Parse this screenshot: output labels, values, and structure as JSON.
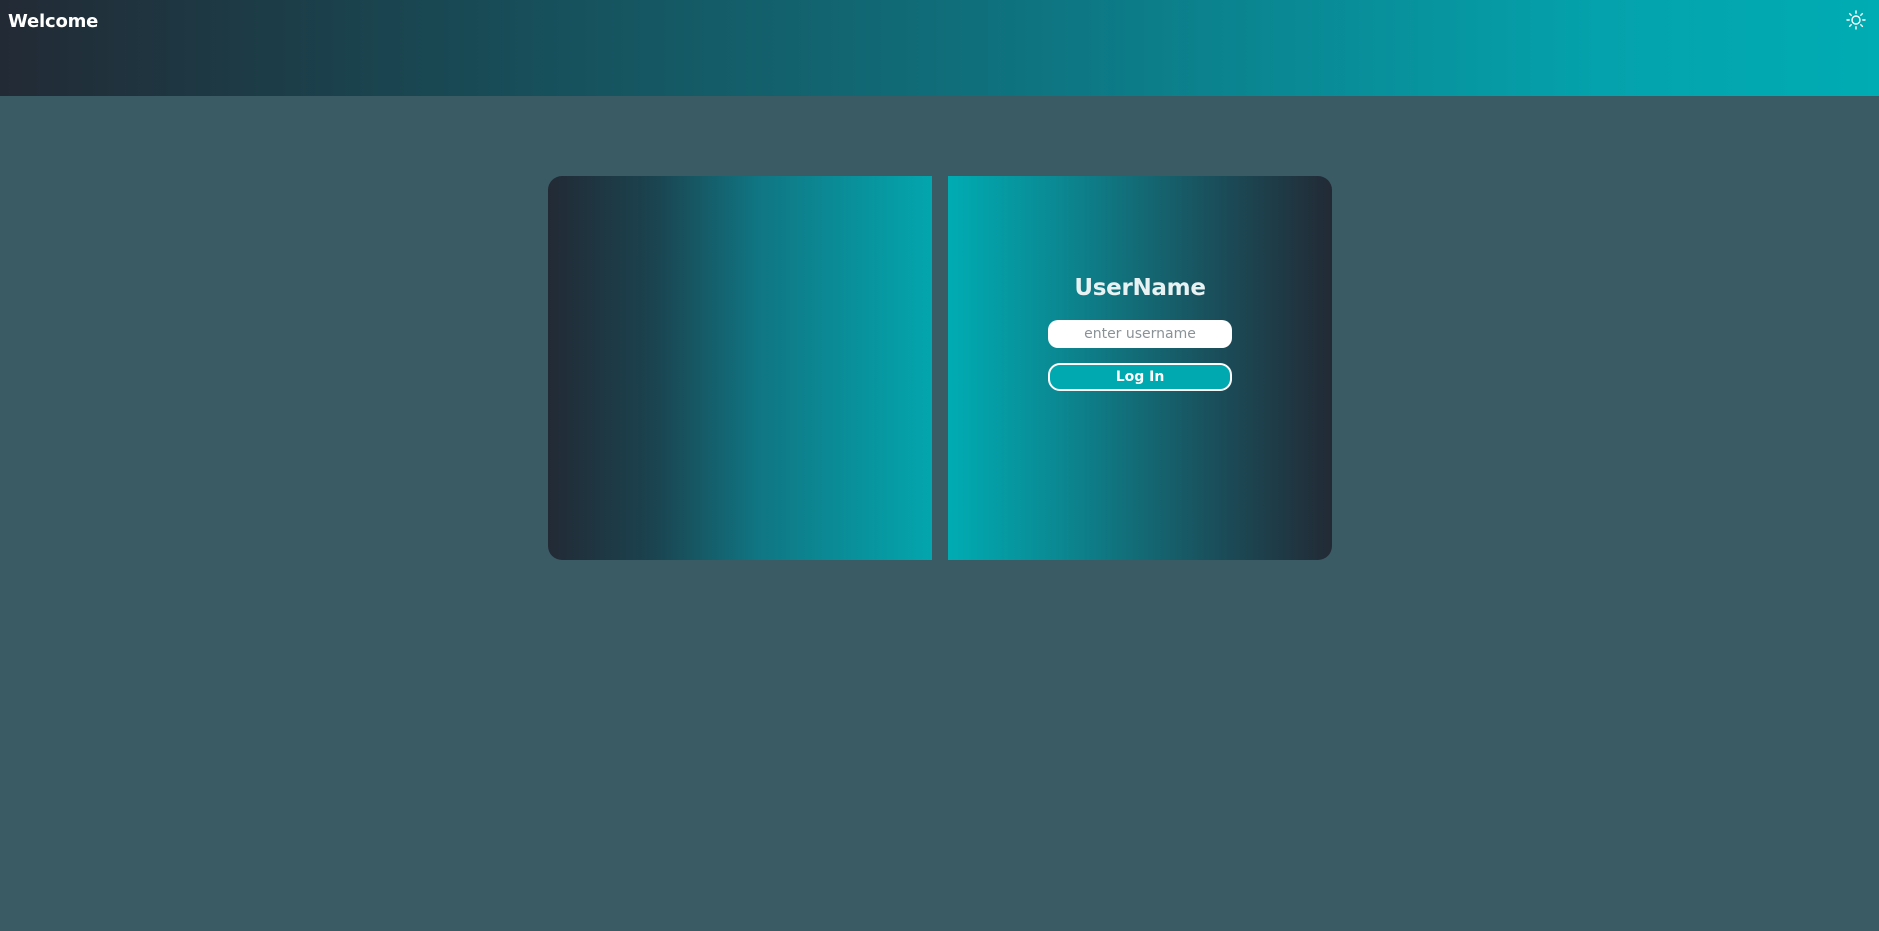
{
  "header": {
    "title": "Welcome",
    "theme_icon": "sun-icon"
  },
  "login": {
    "title": "UserName",
    "username_placeholder": "enter username",
    "username_value": "",
    "login_label": "Log In"
  },
  "colors": {
    "page_background": "#3a5a64",
    "accent": "#00acb3",
    "dark": "#222a35",
    "button_background": "#00a8b0"
  }
}
